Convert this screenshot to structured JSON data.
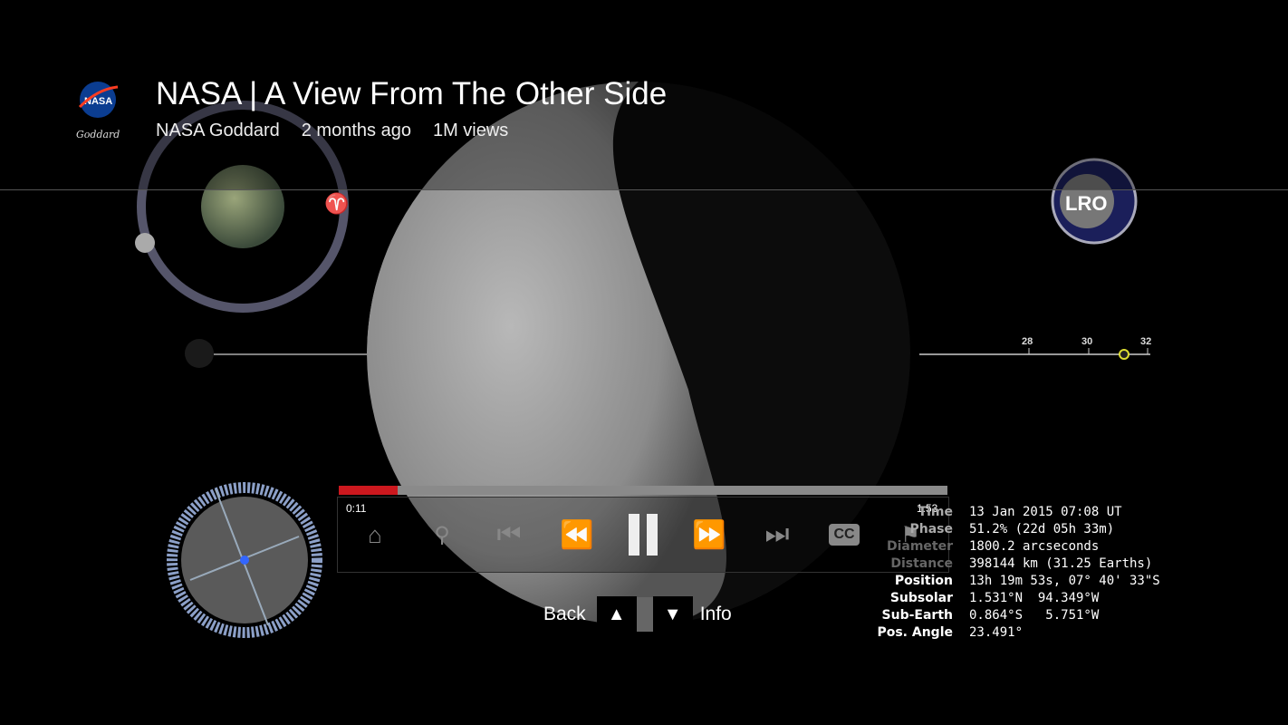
{
  "video": {
    "title": "NASA | A View From The Other Side",
    "channel": "NASA Goddard",
    "age": "2 months ago",
    "views": "1M views",
    "logo_text": "NASA",
    "logo_signature": "Goddard",
    "badge_text": "LRO"
  },
  "player": {
    "current_time": "0:11",
    "duration": "1:53",
    "progress_percent": 9.7,
    "accent": "#cc181e",
    "controls": [
      {
        "name": "home",
        "icon": "home-icon"
      },
      {
        "name": "search",
        "icon": "search-icon"
      },
      {
        "name": "previous",
        "icon": "skip-previous-icon"
      },
      {
        "name": "rewind",
        "icon": "rewind-icon"
      },
      {
        "name": "pause",
        "icon": "pause-icon"
      },
      {
        "name": "fast-forward",
        "icon": "fast-forward-icon"
      },
      {
        "name": "next",
        "icon": "skip-next-icon"
      },
      {
        "name": "captions",
        "icon": "cc-icon",
        "label": "CC"
      },
      {
        "name": "flag",
        "icon": "flag-icon"
      }
    ],
    "nav": {
      "back": "Back",
      "info": "Info"
    }
  },
  "overlay": {
    "scale_ticks": [
      "28",
      "30",
      "32"
    ],
    "hud": [
      {
        "k": "Time",
        "v": "13 Jan 2015 07:08 UT"
      },
      {
        "k": "Phase",
        "v": "51.2% (22d 05h 33m)"
      },
      {
        "k": "Diameter",
        "v": "1800.2 arcseconds"
      },
      {
        "k": "Distance",
        "v": "398144 km (31.25 Earths)"
      },
      {
        "k": "Position",
        "v": "13h 19m 53s, 07° 40' 33\"S"
      },
      {
        "k": "Subsolar",
        "v": "1.531°N  94.349°W"
      },
      {
        "k": "Sub-Earth",
        "v": "0.864°S   5.751°W"
      },
      {
        "k": "Pos. Angle",
        "v": "23.491°"
      }
    ]
  }
}
